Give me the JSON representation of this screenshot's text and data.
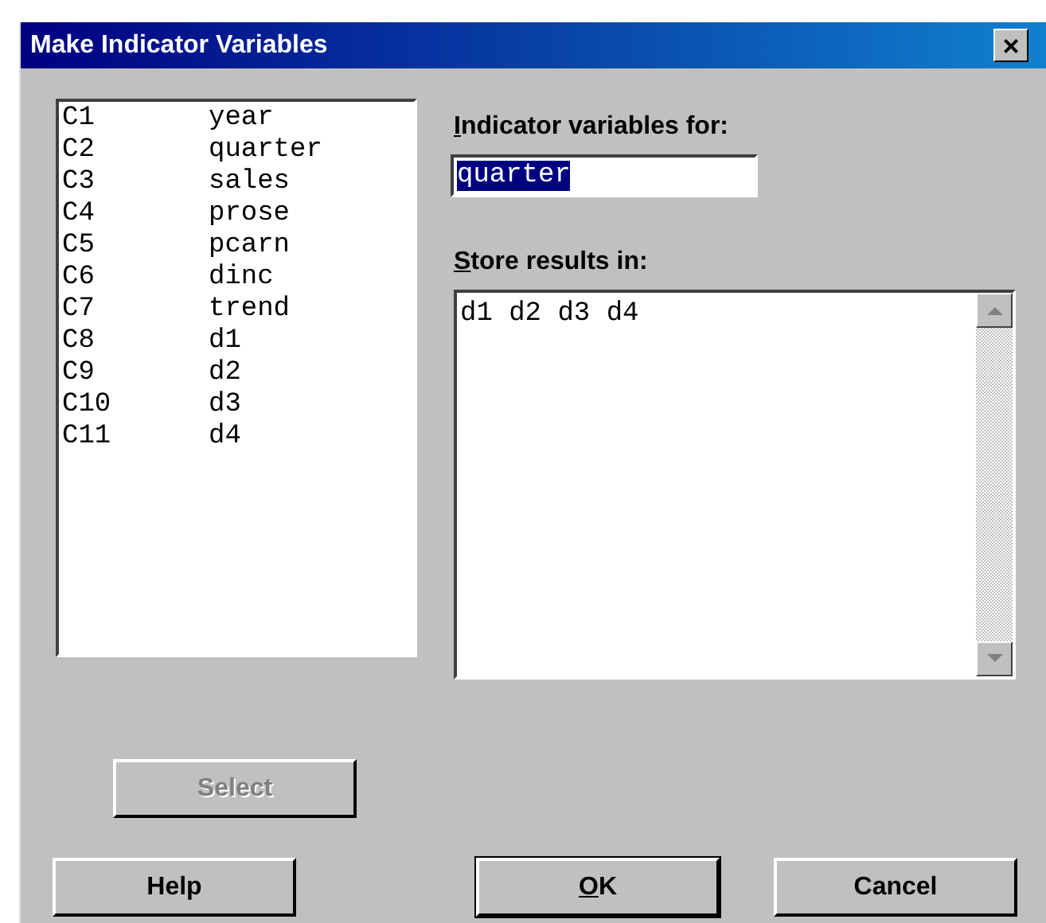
{
  "window": {
    "title": "Make Indicator Variables",
    "close": "×"
  },
  "variables": [
    {
      "column": "C1",
      "name": "year"
    },
    {
      "column": "C2",
      "name": "quarter"
    },
    {
      "column": "C3",
      "name": "sales"
    },
    {
      "column": "C4",
      "name": "prose"
    },
    {
      "column": "C5",
      "name": "pcarn"
    },
    {
      "column": "C6",
      "name": "dinc"
    },
    {
      "column": "C7",
      "name": "trend"
    },
    {
      "column": "C8",
      "name": "d1"
    },
    {
      "column": "C9",
      "name": "d2"
    },
    {
      "column": "C10",
      "name": "d3"
    },
    {
      "column": "C11",
      "name": "d4"
    }
  ],
  "indicator_for": {
    "label_key": "I",
    "label_rest": "ndicator variables for:",
    "value": "quarter",
    "text_selected": true
  },
  "store_results": {
    "label_key": "S",
    "label_rest": "tore results in:",
    "value": "d1 d2 d3 d4"
  },
  "buttons": [
    {
      "kind": "select",
      "label_rest": "Select",
      "disabled": true,
      "default": false
    },
    {
      "kind": "help",
      "label_rest": "Help",
      "disabled": false,
      "default": false
    },
    {
      "kind": "ok",
      "label_key": "O",
      "label_rest": "K",
      "disabled": false,
      "default": true
    },
    {
      "kind": "cancel",
      "label_rest": "Cancel",
      "disabled": false,
      "default": false
    }
  ]
}
